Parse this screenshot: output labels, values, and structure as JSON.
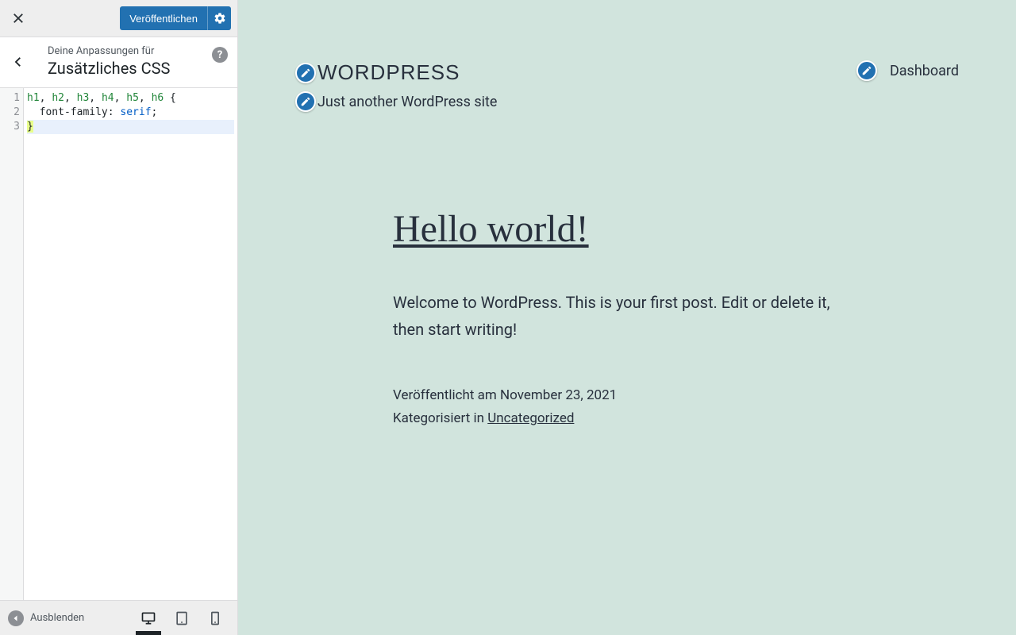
{
  "panel": {
    "publish_label": "Veröffentlichen",
    "heading_pretitle": "Deine Anpassungen für",
    "heading_title": "Zusätzliches CSS"
  },
  "editor": {
    "lines": [
      "1",
      "2",
      "3"
    ],
    "code": {
      "l1_selectors": [
        "h1",
        "h2",
        "h3",
        "h4",
        "h5",
        "h6"
      ],
      "l2_prop": "font-family",
      "l2_val": "serif"
    }
  },
  "footer": {
    "collapse_label": "Ausblenden"
  },
  "preview": {
    "site_title": "WORDPRESS",
    "tagline": "Just another WordPress site",
    "nav_link": "Dashboard",
    "post_title": "Hello world!",
    "post_body": "Welcome to WordPress. This is your first post. Edit or delete it, then start writing!",
    "published_prefix": "Veröffentlicht am ",
    "published_date": "November 23, 2021",
    "categorized_prefix": "Kategorisiert in ",
    "category": "Uncategorized"
  }
}
